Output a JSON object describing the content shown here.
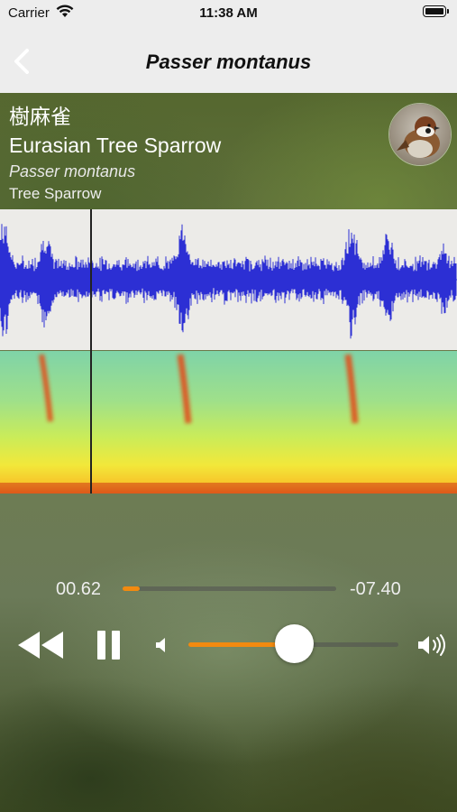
{
  "status_bar": {
    "carrier": "Carrier",
    "time": "11:38 AM"
  },
  "nav": {
    "title": "Passer montanus",
    "back_icon": "chevron-left-icon"
  },
  "species": {
    "name_zh": "樹麻雀",
    "name_en": "Eurasian Tree Sparrow",
    "name_scientific": "Passer montanus",
    "name_short": "Tree Sparrow"
  },
  "player": {
    "elapsed": "00.62",
    "remaining": "-07.40",
    "progress": 0.08,
    "volume": 0.5,
    "rewind_icon": "rewind-icon",
    "pause_icon": "pause-icon",
    "volume_low_icon": "speaker-low-icon",
    "volume_high_icon": "speaker-high-icon"
  },
  "colors": {
    "accent": "#f28a10",
    "waveform": "#2c2fd4"
  }
}
